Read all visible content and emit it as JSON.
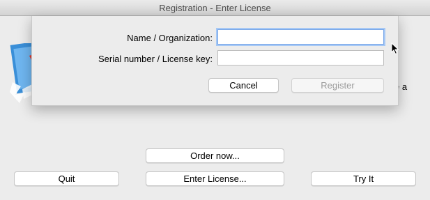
{
  "window": {
    "title": "Registration - Enter License"
  },
  "sheet": {
    "name_label": "Name / Organization:",
    "name_value": "",
    "serial_label": "Serial number / License key:",
    "serial_value": "",
    "cancel_label": "Cancel",
    "register_label": "Register"
  },
  "background": {
    "partial_text": "e a",
    "order_label": "Order now...",
    "quit_label": "Quit",
    "enter_license_label": "Enter License...",
    "try_label": "Try It"
  },
  "colors": {
    "focus_ring": "#a6c8f5",
    "disabled_text": "#9a9a9a",
    "window_bg": "#ececec"
  }
}
